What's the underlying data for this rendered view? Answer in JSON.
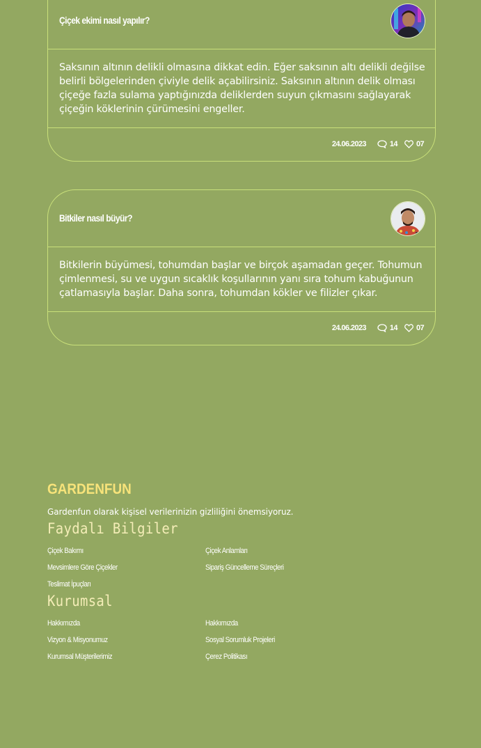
{
  "questions": [
    {
      "title": "Çiçek ekimi nasıl yapılır?",
      "answer": "Saksının altının delikli olmasına dikkat edin. Eğer saksının altı delikli değilse belirli bölgelerinden çiviyle delik açabilirsiniz. Saksının altının delik olması çiçeğe fazla sulama yaptığınızda deliklerden suyun çıkmasını sağlayarak çiçeğin köklerinin çürümesini engeller.",
      "date": "24.06.2023",
      "comments": "14",
      "likes": "07"
    },
    {
      "title": "Bitkiler nasıl büyür?",
      "answer": "Bitkilerin büyümesi, tohumdan başlar ve birçok aşamadan geçer. Tohumun çimlenmesi, su ve uygun sıcaklık koşullarının yanı sıra tohum kabuğunun çatlamasıyla başlar. Daha sonra, tohumdan kökler ve filizler çıkar.",
      "date": "24.06.2023",
      "comments": "14",
      "likes": "07"
    }
  ],
  "footer": {
    "brand": "GARDENFUN",
    "tagline": "Gardenfun olarak kişisel verilerinizin gizliliğini önemsiyoruz.",
    "sections": [
      {
        "title": "Faydalı Bilgiler",
        "links": [
          "Çiçek Bakımı",
          "Çiçek Anlamları",
          "Mevsimlere Göre Çiçekler",
          "Sipariş Güncelleme Süreçleri",
          "Teslimat İpuçları"
        ]
      },
      {
        "title": "Kurumsal",
        "links": [
          "Hakkımızda",
          "Hakkımızda",
          "Vizyon & Misyonumuz",
          "Sosyal Sorumluk Projeleri",
          "Kurumsal Müşterilerimiz",
          "Çerez Politikası"
        ]
      }
    ]
  },
  "colors": {
    "background": "#93a861",
    "border": "#c9e07a",
    "brand": "#f7e37a",
    "section_title": "#f4edb7"
  },
  "icons": [
    "avatar",
    "comment-icon",
    "heart-icon"
  ]
}
